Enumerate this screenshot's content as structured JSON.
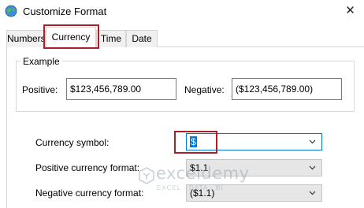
{
  "window": {
    "title": "Customize Format",
    "close_glyph": "✕",
    "icon": "globe-icon"
  },
  "tabs": [
    {
      "label": "Numbers"
    },
    {
      "label": "Currency",
      "active": true
    },
    {
      "label": "Time"
    },
    {
      "label": "Date"
    }
  ],
  "example": {
    "legend": "Example",
    "positive_label": "Positive:",
    "positive_value": "$123,456,789.00",
    "negative_label": "Negative:",
    "negative_value": "($123,456,789.00)"
  },
  "settings": {
    "currency_symbol": {
      "label": "Currency symbol:",
      "value": "$"
    },
    "positive_format": {
      "label": "Positive currency format:",
      "value": "$1.1"
    },
    "negative_format": {
      "label": "Negative currency format:",
      "value": "($1.1)"
    }
  },
  "watermark": {
    "name": "exceldemy",
    "tagline": "EXCEL · DATA · BI"
  },
  "colors": {
    "highlight": "#a91f2a",
    "focus": "#0078d7",
    "selection": "#0078d7"
  }
}
